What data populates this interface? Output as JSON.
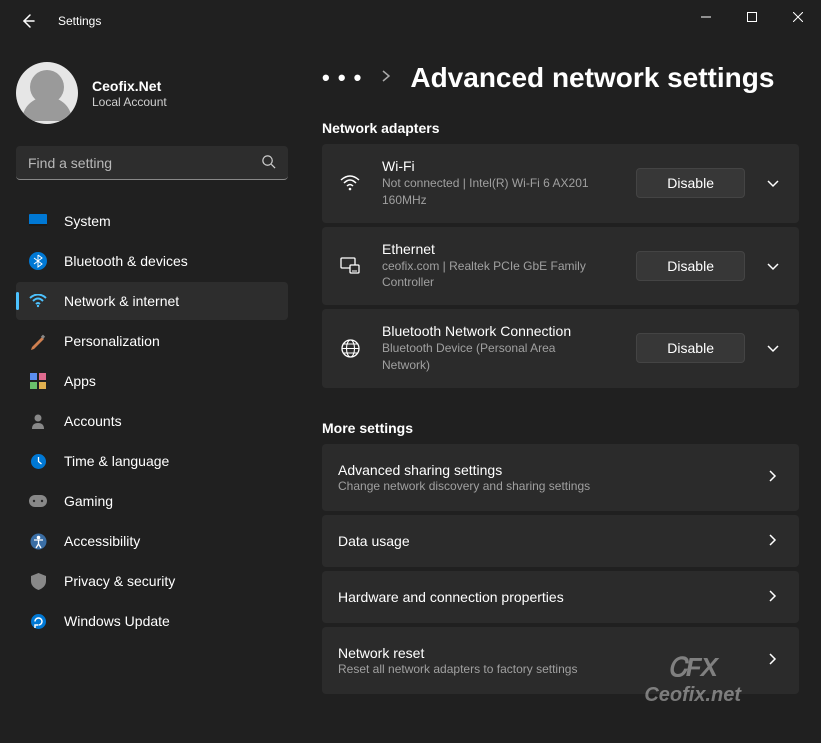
{
  "app": {
    "title": "Settings"
  },
  "user": {
    "name": "Ceofix.Net",
    "sub": "Local Account"
  },
  "search": {
    "placeholder": "Find a setting"
  },
  "nav": {
    "items": [
      {
        "label": "System"
      },
      {
        "label": "Bluetooth & devices"
      },
      {
        "label": "Network & internet"
      },
      {
        "label": "Personalization"
      },
      {
        "label": "Apps"
      },
      {
        "label": "Accounts"
      },
      {
        "label": "Time & language"
      },
      {
        "label": "Gaming"
      },
      {
        "label": "Accessibility"
      },
      {
        "label": "Privacy & security"
      },
      {
        "label": "Windows Update"
      }
    ]
  },
  "page": {
    "title": "Advanced network settings",
    "section_adapters": "Network adapters",
    "section_more": "More settings"
  },
  "adapters": [
    {
      "title": "Wi-Fi",
      "sub": "Not connected | Intel(R) Wi-Fi 6 AX201 160MHz",
      "button": "Disable"
    },
    {
      "title": "Ethernet",
      "sub": "ceofix.com | Realtek PCIe GbE Family Controller",
      "button": "Disable"
    },
    {
      "title": "Bluetooth Network Connection",
      "sub": "Bluetooth Device (Personal Area Network)",
      "button": "Disable"
    }
  ],
  "more_rows": [
    {
      "title": "Advanced sharing settings",
      "sub": "Change network discovery and sharing settings"
    },
    {
      "title": "Data usage",
      "sub": ""
    },
    {
      "title": "Hardware and connection properties",
      "sub": ""
    },
    {
      "title": "Network reset",
      "sub": "Reset all network adapters to factory settings"
    }
  ],
  "watermark": {
    "logo": "ᏟFX",
    "text": "Ceofix.net"
  }
}
